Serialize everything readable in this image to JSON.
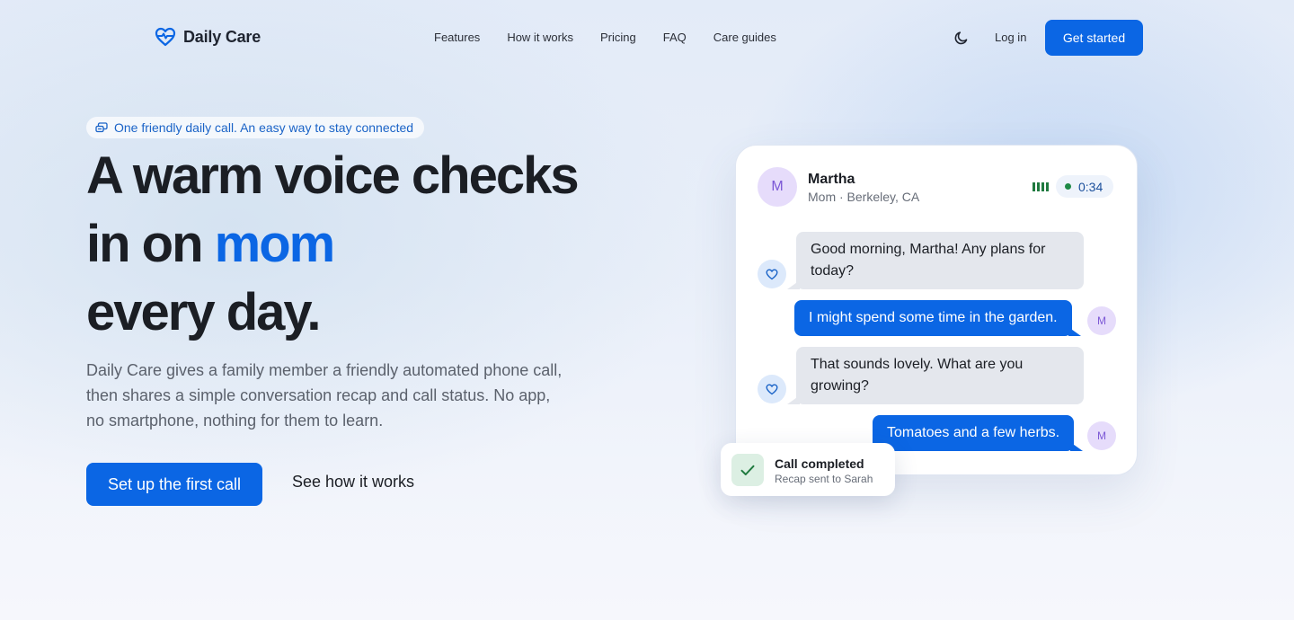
{
  "nav": {
    "brand": "Daily Care",
    "links": [
      "Features",
      "How it works",
      "Pricing",
      "FAQ",
      "Care guides"
    ],
    "theme_toggle_icon": "moon-icon",
    "login": "Log in",
    "cta": "Get started"
  },
  "hero": {
    "eyebrow": "One friendly daily call. An easy way to stay connected",
    "headline_line1": "A warm voice checks",
    "headline_line2_prefix": "in on ",
    "headline_accent": "mom",
    "headline_line3": "every day.",
    "description": "Daily Care gives a family member a friendly automated phone call, then shares a simple conversation recap and call status. No app, no smartphone, nothing for them to learn.",
    "primary_button": "Set up the first call",
    "secondary_button": "See how it works"
  },
  "call_card": {
    "avatar_initial": "M",
    "caller_name": "Martha",
    "caller_subtitle": "Mom · Berkeley, CA",
    "call_timer": "0:34",
    "messages": [
      {
        "from": "agent",
        "text": "Good morning, Martha! Any plans for today?"
      },
      {
        "from": "user",
        "text": "I might spend some time in the garden.",
        "initial": "M"
      },
      {
        "from": "agent",
        "text": "That sounds lovely. What are you growing?"
      },
      {
        "from": "user",
        "text": "Tomatoes and a few herbs.",
        "initial": "M"
      }
    ]
  },
  "toast": {
    "title": "Call completed",
    "subtitle": "Recap sent to Sarah"
  },
  "colors": {
    "primary": "#0b66e4",
    "text": "#1b1e24",
    "muted": "#5b616c",
    "success": "#1f8a46",
    "avatar_bg": "#e6dcfb"
  }
}
